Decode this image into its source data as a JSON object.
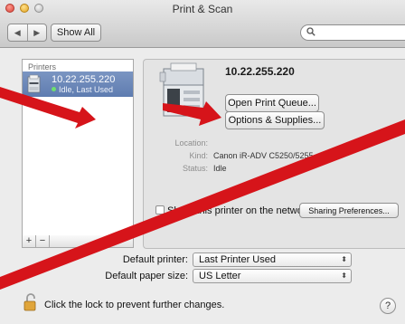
{
  "window": {
    "title": "Print & Scan"
  },
  "toolbar": {
    "back_label": "◀",
    "forward_label": "▶",
    "show_all_label": "Show All",
    "search_placeholder": ""
  },
  "sidebar": {
    "header": "Printers",
    "items": [
      {
        "name": "10.22.255.220",
        "status": "Idle, Last Used"
      }
    ],
    "add_label": "+",
    "remove_label": "−"
  },
  "detail": {
    "printer_address": "10.22.255.220",
    "open_queue_label": "Open Print Queue...",
    "options_label": "Options & Supplies...",
    "info": {
      "location_label": "Location:",
      "location_value": "",
      "kind_label": "Kind:",
      "kind_value": "Canon iR-ADV C5250/5255",
      "status_label": "Status:",
      "status_value": "Idle"
    },
    "share_label": "Share this printer on the network",
    "sharing_prefs_label": "Sharing Preferences..."
  },
  "defaults": {
    "printer_label": "Default printer:",
    "printer_value": "Last Printer Used",
    "paper_label": "Default paper size:",
    "paper_value": "US Letter"
  },
  "footer": {
    "lock_text": "Click the lock to prevent further changes.",
    "help_label": "?"
  },
  "colors": {
    "annotation_red": "#d6141a",
    "selection_blue": "#6b87b9"
  }
}
